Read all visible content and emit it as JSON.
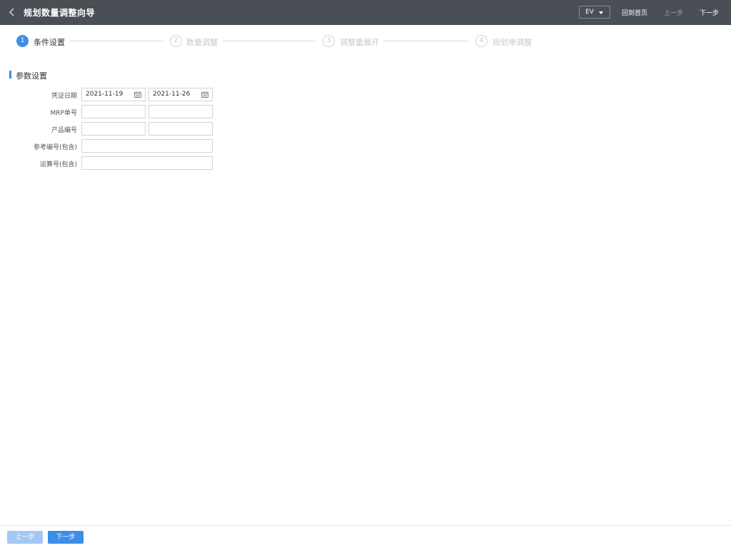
{
  "header": {
    "title": "规划数量调整向导",
    "org_value": "EV",
    "home_label": "回到首页",
    "prev_label": "上一步",
    "next_label": "下一步"
  },
  "steps": [
    {
      "number": "1",
      "label": "条件设置",
      "active": true
    },
    {
      "number": "2",
      "label": "数量调整",
      "active": false
    },
    {
      "number": "3",
      "label": "调整量展开",
      "active": false
    },
    {
      "number": "4",
      "label": "规划单调整",
      "active": false
    }
  ],
  "section": {
    "title": "参数设置"
  },
  "form": {
    "voucher_date_label": "凭证日期",
    "voucher_date_from": "2021-11-19",
    "voucher_date_to": "2021-11-26",
    "mrp_no_label": "MRP单号",
    "mrp_no_from": "",
    "mrp_no_to": "",
    "product_no_label": "产品编号",
    "product_no_from": "",
    "product_no_to": "",
    "ref_no_label": "参考编号(包含)",
    "ref_no_value": "",
    "calc_no_label": "运算号(包含)",
    "calc_no_value": ""
  },
  "footer": {
    "prev_label": "上一步",
    "next_label": "下一步"
  },
  "colors": {
    "header_bg": "#4a4f56",
    "accent": "#3d8ee8",
    "disabled_button": "#a3c8f2"
  }
}
